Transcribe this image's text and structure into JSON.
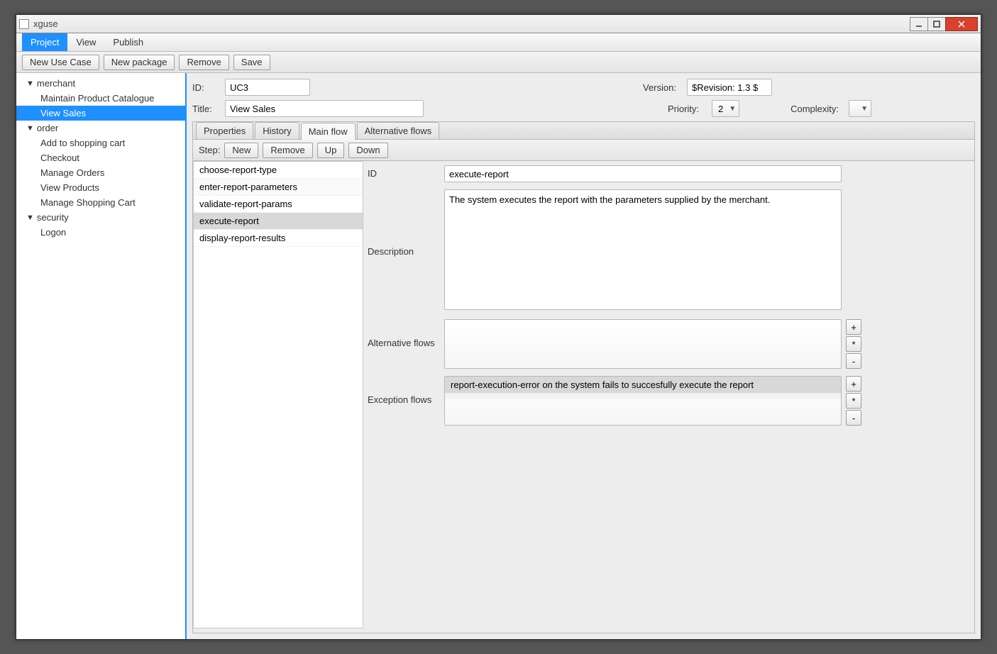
{
  "window": {
    "title": "xguse"
  },
  "menu": {
    "project": "Project",
    "view": "View",
    "publish": "Publish"
  },
  "toolbar": {
    "new_usecase": "New Use Case",
    "new_package": "New package",
    "remove": "Remove",
    "save": "Save"
  },
  "tree": {
    "merchant": {
      "label": "merchant",
      "items": [
        "Maintain Product Catalogue",
        "View Sales"
      ]
    },
    "order": {
      "label": "order",
      "items": [
        "Add to shopping cart",
        "Checkout",
        "Manage Orders",
        "View Products",
        "Manage Shopping Cart"
      ]
    },
    "security": {
      "label": "security",
      "items": [
        "Logon"
      ]
    }
  },
  "form": {
    "id_label": "ID:",
    "id_value": "UC3",
    "title_label": "Title:",
    "title_value": "View Sales",
    "version_label": "Version:",
    "version_value": "$Revision: 1.3 $",
    "priority_label": "Priority:",
    "priority_value": "2",
    "complexity_label": "Complexity:",
    "complexity_value": ""
  },
  "tabs": {
    "properties": "Properties",
    "history": "History",
    "mainflow": "Main flow",
    "altflows": "Alternative flows"
  },
  "step_toolbar": {
    "label": "Step:",
    "new": "New",
    "remove": "Remove",
    "up": "Up",
    "down": "Down"
  },
  "steps": [
    "choose-report-type",
    "enter-report-parameters",
    "validate-report-params",
    "execute-report",
    "display-report-results"
  ],
  "details": {
    "id_label": "ID",
    "id_value": "execute-report",
    "desc_label": "Description",
    "desc_value": "The system executes the report with the parameters supplied by the merchant.",
    "alt_label": "Alternative flows",
    "exc_label": "Exception flows",
    "exc_row": "report-execution-error on the system fails to succesfully execute the report",
    "btn_plus": "+",
    "btn_star": "*",
    "btn_minus": "-"
  }
}
